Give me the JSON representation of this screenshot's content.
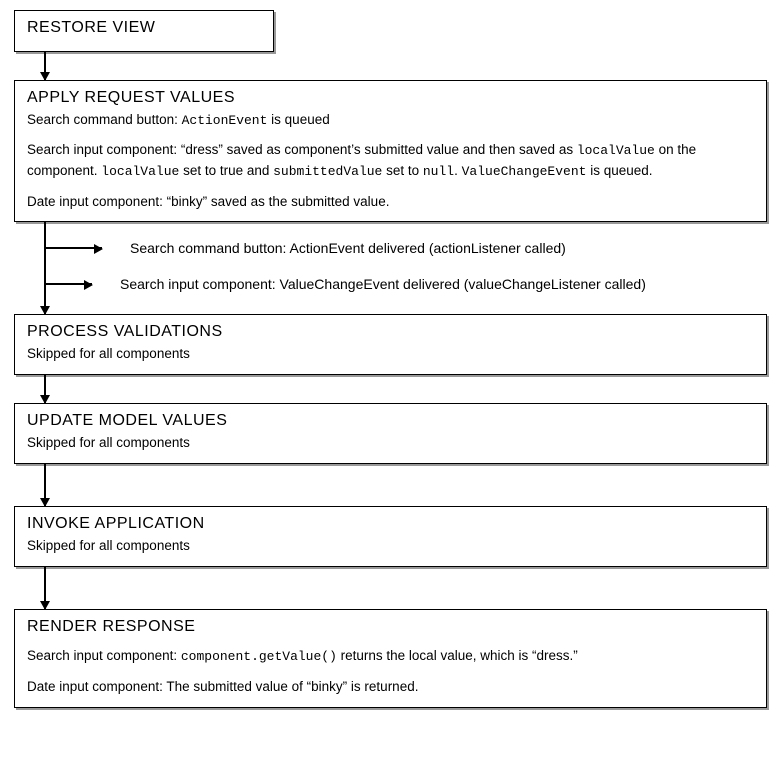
{
  "phases": {
    "restore": {
      "title": "RESTORE VIEW"
    },
    "apply": {
      "title": "APPLY REQUEST VALUES",
      "line1_prefix": "Search command button: ",
      "line1_code": "ActionEvent",
      "line1_suffix": " is queued",
      "p2_a": "Search input component: “dress” saved as component’s submitted value and then saved as ",
      "p2_code1": "localValue",
      "p2_b": " on the component. ",
      "p2_code2": "localValue",
      "p2_c": " set to true and ",
      "p2_code3": "submittedValue",
      "p2_d": " set to ",
      "p2_code4": "null",
      "p2_e": ". ",
      "p2_code5": "ValueChangeEvent",
      "p2_f": " is queued.",
      "p3": "Date input component: “binky” saved as the submitted value."
    },
    "branches": {
      "b1": "Search command button: ActionEvent delivered (actionListener called)",
      "b2": "Search input component: ValueChangeEvent delivered (valueChangeListener called)"
    },
    "process": {
      "title": "PROCESS VALIDATIONS",
      "sub": "Skipped for all components"
    },
    "update": {
      "title": "UPDATE MODEL VALUES",
      "sub": "Skipped for all components"
    },
    "invoke": {
      "title": "INVOKE APPLICATION",
      "sub": "Skipped for all components"
    },
    "render": {
      "title": "RENDER RESPONSE",
      "p1_a": "Search input component: ",
      "p1_code": "component.getValue()",
      "p1_b": " returns the local value, which is “dress.”",
      "p2": "Date input component: The submitted value of “binky” is returned."
    }
  }
}
